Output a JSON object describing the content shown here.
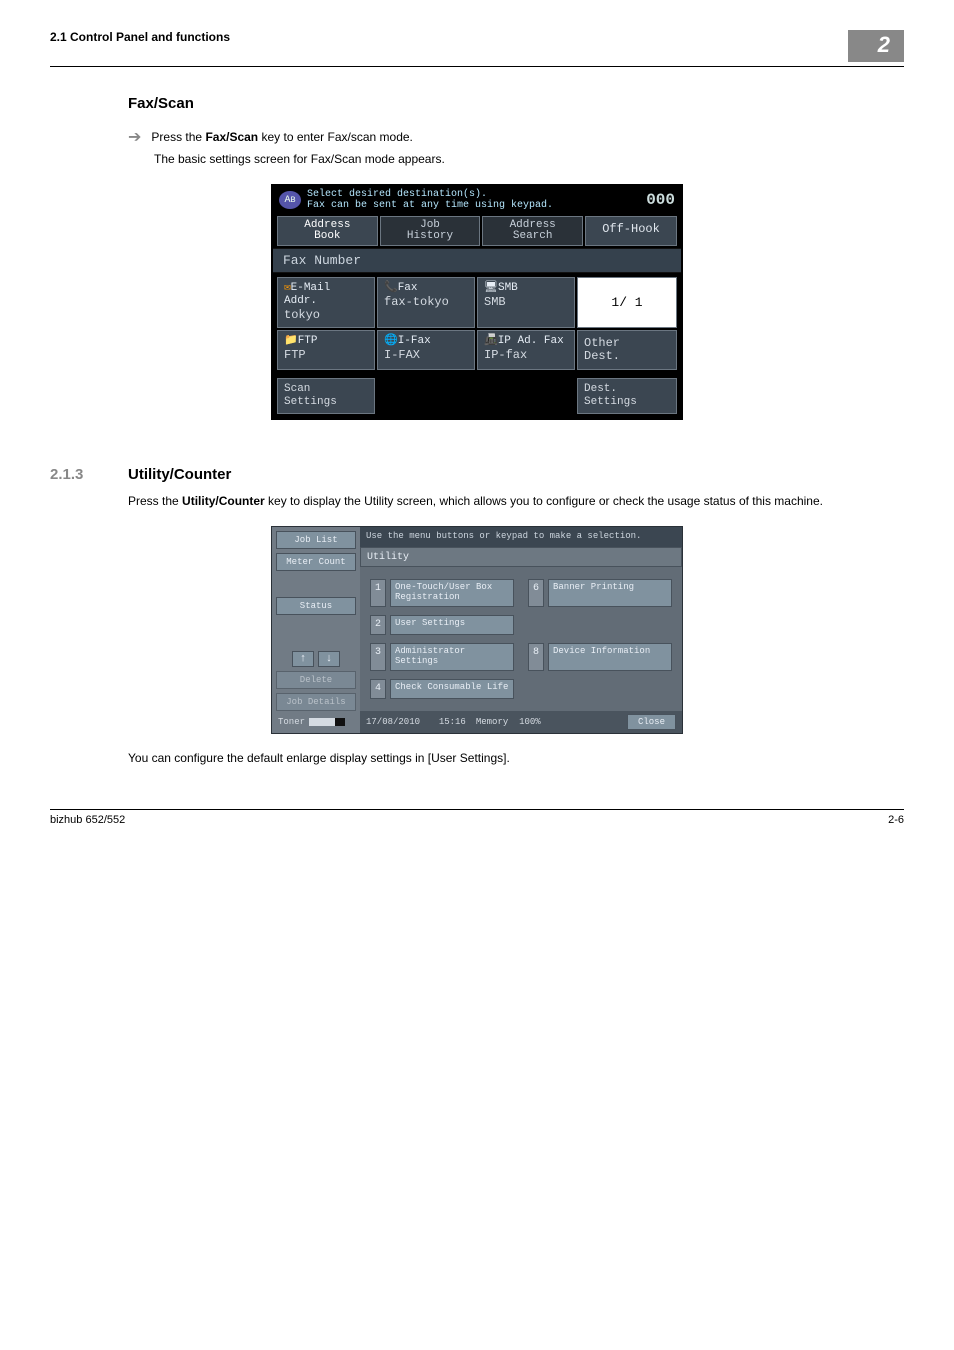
{
  "header": {
    "left": "2.1    Control Panel and functions",
    "right": "2"
  },
  "section_a": {
    "title": "Fax/Scan",
    "line1_prefix": "Press the ",
    "line1_bold": "Fax/Scan",
    "line1_suffix": " key to enter Fax/scan mode.",
    "line2": "The basic settings screen for Fax/Scan mode appears."
  },
  "faxscan_fig": {
    "top_msg_l1": "Select desired destination(s).",
    "top_msg_l2": "Fax can be sent at any time using keypad.",
    "count": "000",
    "tabs": {
      "addr_book": "Address\nBook",
      "job_hist": "Job\nHistory",
      "addr_search": "Address\nSearch"
    },
    "off_hook": "Off-Hook",
    "fax_number_bar": "Fax Number",
    "cells": [
      {
        "lbl": "E-Mail Addr.",
        "nm": "tokyo"
      },
      {
        "lbl": "Fax",
        "nm": "fax-tokyo"
      },
      {
        "lbl": "SMB",
        "nm": "SMB"
      }
    ],
    "page": "1/   1",
    "cells2": [
      {
        "lbl": "FTP",
        "nm": "FTP"
      },
      {
        "lbl": "I-Fax",
        "nm": "I-FAX"
      },
      {
        "lbl": "IP Ad. Fax",
        "nm": "IP-fax"
      }
    ],
    "other_dest": "Other\nDest.",
    "scan_settings": "Scan\nSettings",
    "dest_settings": "Dest.\nSettings"
  },
  "section_b": {
    "num": "2.1.3",
    "title": "Utility/Counter",
    "para_prefix": "Press the ",
    "para_bold": "Utility/Counter",
    "para_suffix": " key to display the Utility screen, which allows you to configure or check the usage status of this machine.",
    "after_fig": "You can configure the default enlarge display settings in [User Settings]."
  },
  "utility_fig": {
    "side": {
      "job_list": "Job List",
      "meter_count": "Meter Count",
      "status": "Status",
      "delete": "Delete",
      "job_details": "Job Details",
      "toner": "Toner"
    },
    "hdr": "Use the menu buttons or keypad to make a selection.",
    "title": "Utility",
    "menu": {
      "1": "One-Touch/User Box Registration",
      "2": "User Settings",
      "3": "Administrator Settings",
      "4": "Check Consumable Life",
      "6": "Banner Printing",
      "8": "Device Information"
    },
    "date": "17/08/2010",
    "time": "15:16",
    "memory_label": "Memory",
    "memory_pct": "100%",
    "close": "Close"
  },
  "footer": {
    "left": "bizhub 652/552",
    "right": "2-6"
  }
}
